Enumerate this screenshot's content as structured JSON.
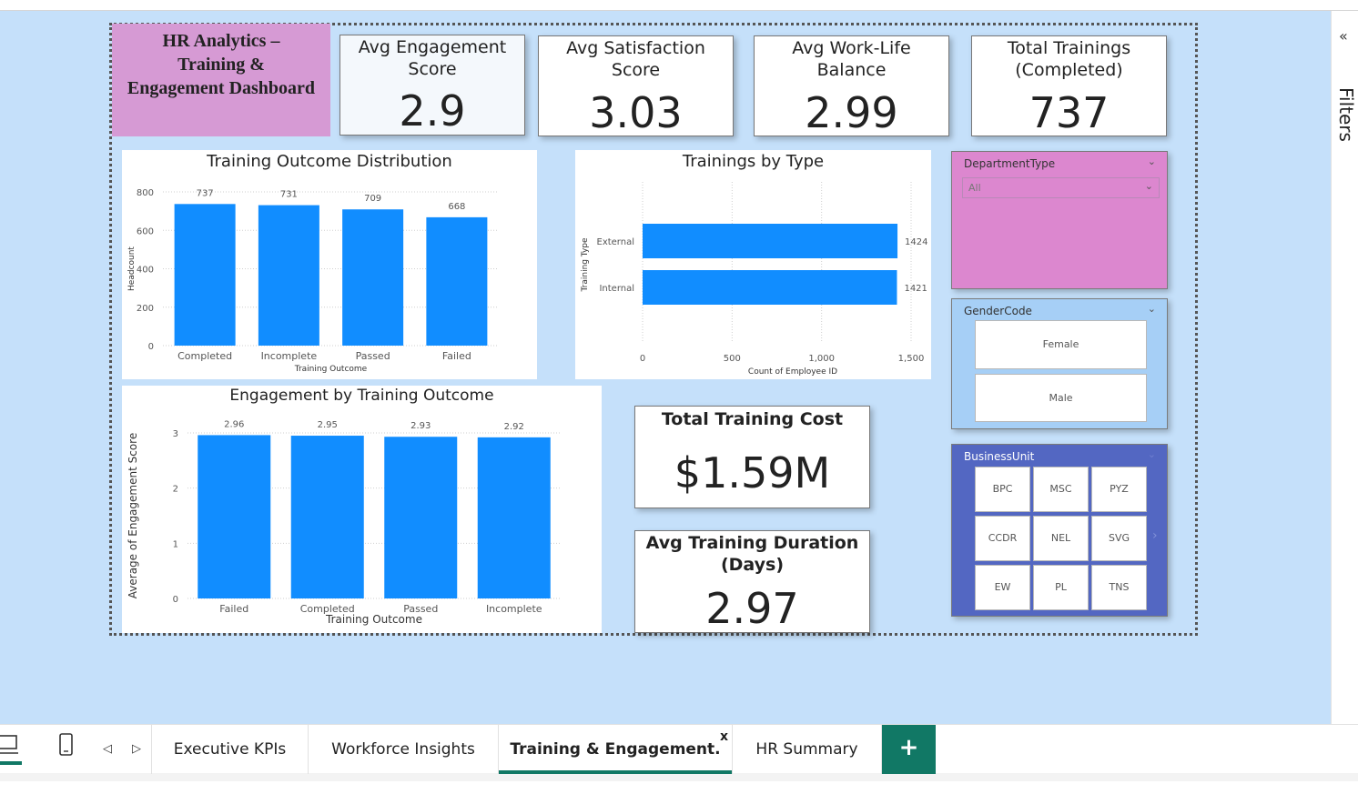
{
  "title_box": {
    "line1": "HR Analytics –",
    "line2": "Training &",
    "line3": "Engagement Dashboard"
  },
  "kpis": [
    {
      "label1": "Avg Engagement",
      "label2": "Score",
      "value": "2.9"
    },
    {
      "label1": "Avg Satisfaction",
      "label2": "Score",
      "value": "3.03"
    },
    {
      "label1": "Avg Work-Life",
      "label2": "Balance",
      "value": "2.99"
    },
    {
      "label1": "Total Trainings",
      "label2": "(Completed)",
      "value": "737"
    }
  ],
  "total_cost": {
    "label": "Total Training Cost",
    "value": "$1.59M"
  },
  "avg_duration": {
    "label1": "Avg Training Duration",
    "label2": "(Days)",
    "value": "2.97"
  },
  "slicers": {
    "department": {
      "title": "DepartmentType",
      "selected": "All"
    },
    "gender": {
      "title": "GenderCode",
      "options": [
        "Female",
        "Male"
      ]
    },
    "business_unit": {
      "title": "BusinessUnit",
      "options": [
        "BPC",
        "MSC",
        "PYZ",
        "CCDR",
        "NEL",
        "SVG",
        "EW",
        "PL",
        "TNS"
      ]
    }
  },
  "filters_label": "Filters",
  "tabs": [
    "Executive KPIs",
    "Workforce Insights",
    "Training & Engagement.",
    "HR Summary"
  ],
  "active_tab": "Training & Engagement.",
  "colors": {
    "bar": "#118dff",
    "canvas": "#c5e0fa",
    "accent": "#117865",
    "title_bg": "#d69ad4",
    "slicer_pink": "#dc87cf",
    "slicer_blue": "#a6cff6",
    "slicer_indigo": "#5367c2"
  },
  "chart_data": [
    {
      "type": "bar",
      "title": "Training Outcome Distribution",
      "categories": [
        "Completed",
        "Incomplete",
        "Passed",
        "Failed"
      ],
      "values": [
        737,
        731,
        709,
        668
      ],
      "xlabel": "Training Outcome",
      "ylabel": "Headcount",
      "ylim": [
        0,
        800
      ],
      "yticks": [
        0,
        200,
        400,
        600,
        800
      ],
      "grid": true
    },
    {
      "type": "bar",
      "orientation": "horizontal",
      "title": "Trainings by Type",
      "categories": [
        "External",
        "Internal"
      ],
      "values": [
        1424,
        1421
      ],
      "xlabel": "Count of Employee ID",
      "ylabel": "Training Type",
      "xlim": [
        0,
        1600
      ],
      "xticks": [
        "0",
        "500",
        "1,000",
        "1,500"
      ],
      "grid": true
    },
    {
      "type": "bar",
      "title": "Engagement by Training Outcome",
      "categories": [
        "Failed",
        "Completed",
        "Passed",
        "Incomplete"
      ],
      "values": [
        2.96,
        2.95,
        2.93,
        2.92
      ],
      "xlabel": "Training Outcome",
      "ylabel": "Average of Engagement Score",
      "ylim": [
        0,
        3
      ],
      "yticks": [
        0,
        1,
        2,
        3
      ],
      "grid": true
    }
  ]
}
